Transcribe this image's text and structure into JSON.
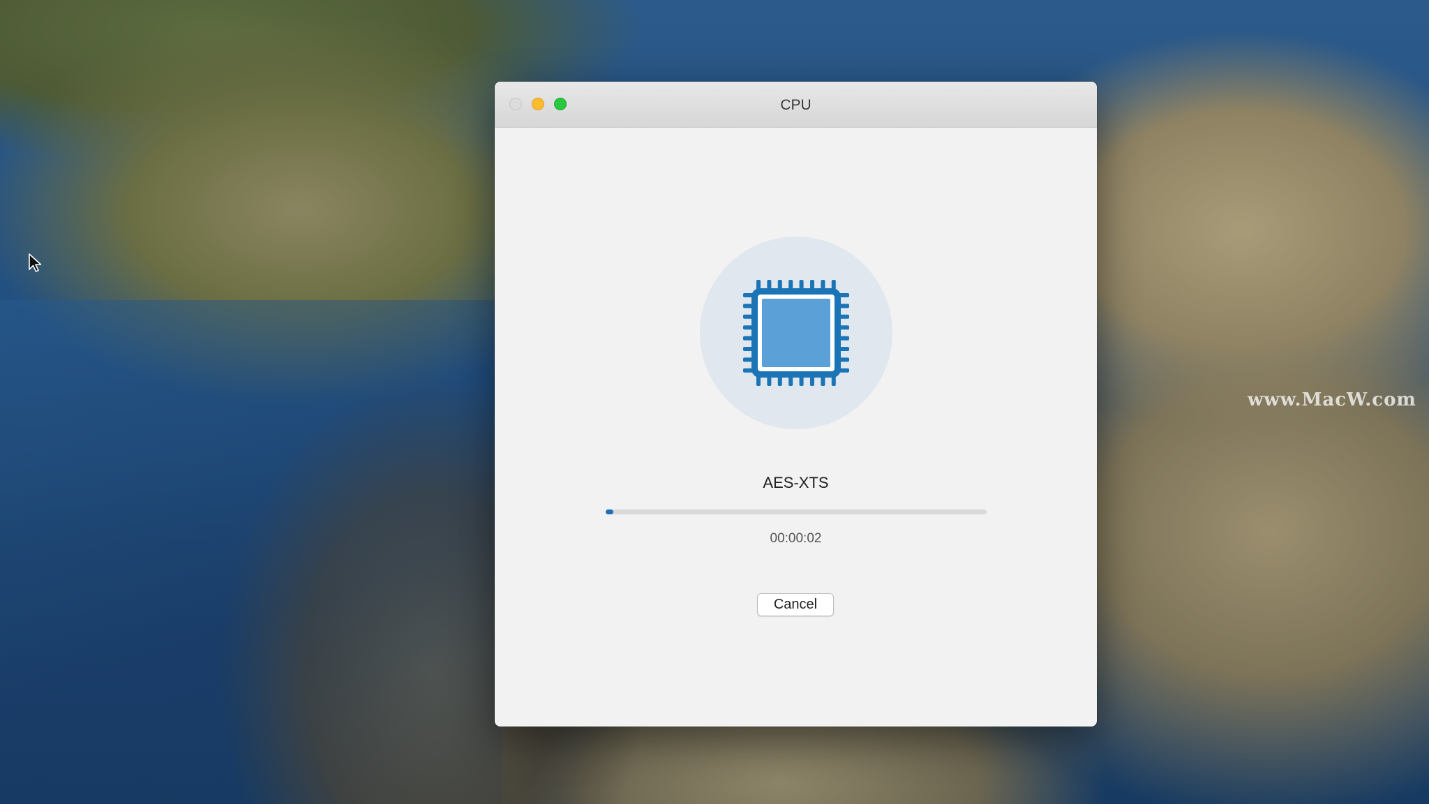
{
  "window": {
    "title": "CPU"
  },
  "task": {
    "icon": "cpu-chip-icon",
    "algorithm": "AES-XTS",
    "progress_percent": 2,
    "elapsed_time": "00:00:02",
    "cancel_label": "Cancel"
  },
  "desktop": {
    "watermark": "www.MacW.com"
  },
  "colors": {
    "accent": "#1c6fb8",
    "chip_outline": "#1a74b5",
    "chip_fill": "#5ba0d6",
    "icon_background": "#e1e7ee",
    "window_background": "#f2f2f2",
    "traffic_close": "#dcdcdc",
    "traffic_minimize": "#fdbc2e",
    "traffic_maximize": "#28c840"
  }
}
